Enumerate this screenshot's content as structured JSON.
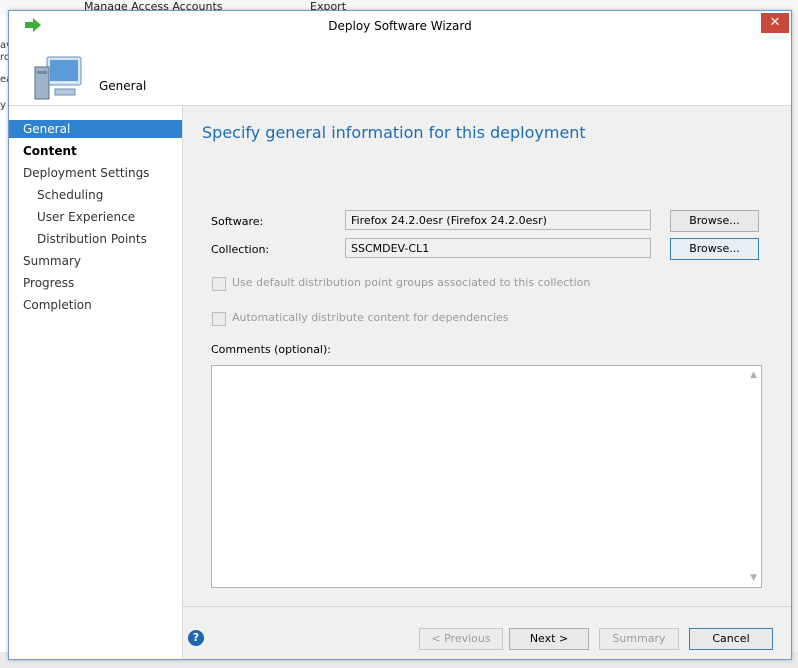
{
  "background_app": {
    "toolbar": {
      "manage_access_accounts": "Manage Access Accounts",
      "export": "Export"
    },
    "left_fragments": [
      "av",
      "rc",
      "ea",
      "y"
    ]
  },
  "dialog": {
    "title": "Deploy Software Wizard",
    "close_label": "✕",
    "header_title": "General"
  },
  "nav": {
    "items": [
      {
        "label": "General",
        "state": "selected"
      },
      {
        "label": "Content",
        "state": "bold"
      },
      {
        "label": "Deployment Settings",
        "state": "normal"
      },
      {
        "label": "Scheduling",
        "state": "sub"
      },
      {
        "label": "User Experience",
        "state": "sub"
      },
      {
        "label": "Distribution Points",
        "state": "sub"
      },
      {
        "label": "Summary",
        "state": "normal"
      },
      {
        "label": "Progress",
        "state": "normal"
      },
      {
        "label": "Completion",
        "state": "normal"
      }
    ]
  },
  "content": {
    "heading": "Specify general information for this deployment",
    "software_label": "Software:",
    "software_value": "Firefox 24.2.0esr (Firefox 24.2.0esr)",
    "collection_label": "Collection:",
    "collection_value": "SSCMDEV-CL1",
    "browse_label": "Browse...",
    "checkbox_default_dp": "Use default distribution point groups associated to this collection",
    "checkbox_auto_distribute": "Automatically distribute content for dependencies",
    "comments_label": "Comments (optional):",
    "comments_value": ""
  },
  "footer": {
    "help_icon": "?",
    "previous": "< Previous",
    "next": "Next >",
    "summary": "Summary",
    "cancel": "Cancel"
  },
  "colors": {
    "selected_nav": "#2f82cf",
    "heading": "#1e6cb4",
    "close_button": "#c9483b"
  }
}
